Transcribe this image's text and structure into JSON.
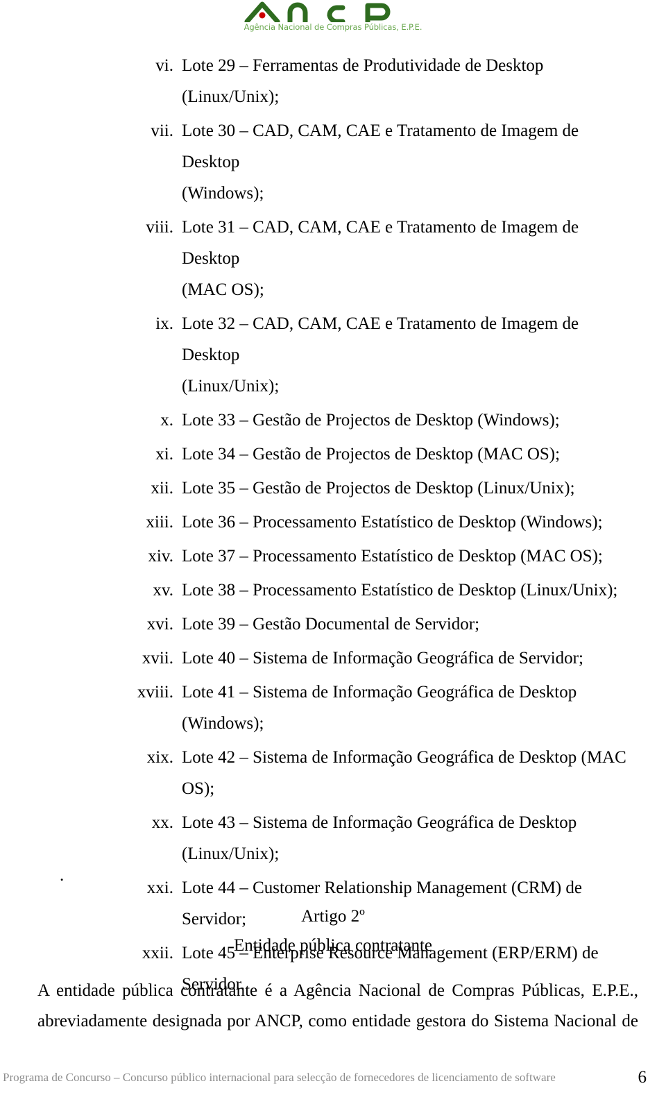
{
  "header": {
    "logo_text": "ancp",
    "logo_tagline": "Agência Nacional de Compras Públicas, E.P.E.",
    "logo_color": "#2e6b1f",
    "logo_accent_color": "#cc0000",
    "logo_tagline_color": "#6aa84f"
  },
  "lot_list": {
    "items": [
      {
        "marker": "vi.",
        "text": "Lote 29 – Ferramentas de Produtividade de Desktop (Linux/Unix);",
        "justified": false,
        "tail": ""
      },
      {
        "marker": "vii.",
        "text": "Lote 30 – CAD, CAM, CAE e Tratamento de Imagem de Desktop",
        "justified": false,
        "tail": "(Windows);"
      },
      {
        "marker": "viii.",
        "text": "Lote 31 – CAD, CAM, CAE e Tratamento de Imagem de Desktop",
        "justified": false,
        "tail": "(MAC OS);"
      },
      {
        "marker": "ix.",
        "text": "Lote 32 – CAD, CAM, CAE e Tratamento de Imagem de Desktop",
        "justified": false,
        "tail": "(Linux/Unix);"
      },
      {
        "marker": "x.",
        "text": "Lote 33 – Gestão de Projectos de Desktop (Windows);",
        "justified": false,
        "tail": ""
      },
      {
        "marker": "xi.",
        "text": "Lote 34 – Gestão de Projectos de Desktop (MAC OS);",
        "justified": false,
        "tail": ""
      },
      {
        "marker": "xii.",
        "text": "Lote 35 – Gestão de Projectos de Desktop (Linux/Unix);",
        "justified": false,
        "tail": ""
      },
      {
        "marker": "xiii.",
        "text": "Lote 36 – Processamento Estatístico de Desktop (Windows);",
        "justified": false,
        "tail": ""
      },
      {
        "marker": "xiv.",
        "text": "Lote 37 – Processamento Estatístico de Desktop (MAC OS);",
        "justified": false,
        "tail": ""
      },
      {
        "marker": "xv.",
        "text": "Lote 38 – Processamento Estatístico de Desktop (Linux/Unix);",
        "justified": false,
        "tail": ""
      },
      {
        "marker": "xvi.",
        "text": "Lote 39 – Gestão Documental de Servidor;",
        "justified": false,
        "tail": ""
      },
      {
        "marker": "xvii.",
        "text": "Lote 40 – Sistema de Informação Geográfica de Servidor;",
        "justified": false,
        "tail": ""
      },
      {
        "marker": "xviii.",
        "text": "Lote 41 – Sistema de Informação Geográfica de Desktop",
        "justified": true,
        "tail": "(Windows);"
      },
      {
        "marker": "xix.",
        "text": "Lote 42 – Sistema de Informação Geográfica de Desktop (MAC",
        "justified": true,
        "tail": "OS);"
      },
      {
        "marker": "xx.",
        "text": "Lote 43 – Sistema de Informação Geográfica de Desktop",
        "justified": true,
        "tail": "(Linux/Unix);"
      },
      {
        "marker": "xxi.",
        "text": "Lote 44 – Customer Relationship Management (CRM) de",
        "justified": true,
        "tail": "Servidor;"
      },
      {
        "marker": "xxii.",
        "text": "Lote 45 – Enterprise Resource Management (ERP/ERM) de",
        "justified": true,
        "tail": "Servidor."
      }
    ]
  },
  "stray_period": ".",
  "article": {
    "heading": "Artigo 2º",
    "subheading": "Entidade pública contratante"
  },
  "body": {
    "line1": "A entidade pública contratante é a Agência Nacional de Compras Públicas, E.P.E.,",
    "line2": "abreviadamente designada por ANCP, como entidade gestora do Sistema Nacional de"
  },
  "footer": {
    "text": "Programa de Concurso – Concurso público internacional para selecção de fornecedores de licenciamento de software",
    "page_number": "6",
    "text_color": "#8c8c8c"
  }
}
